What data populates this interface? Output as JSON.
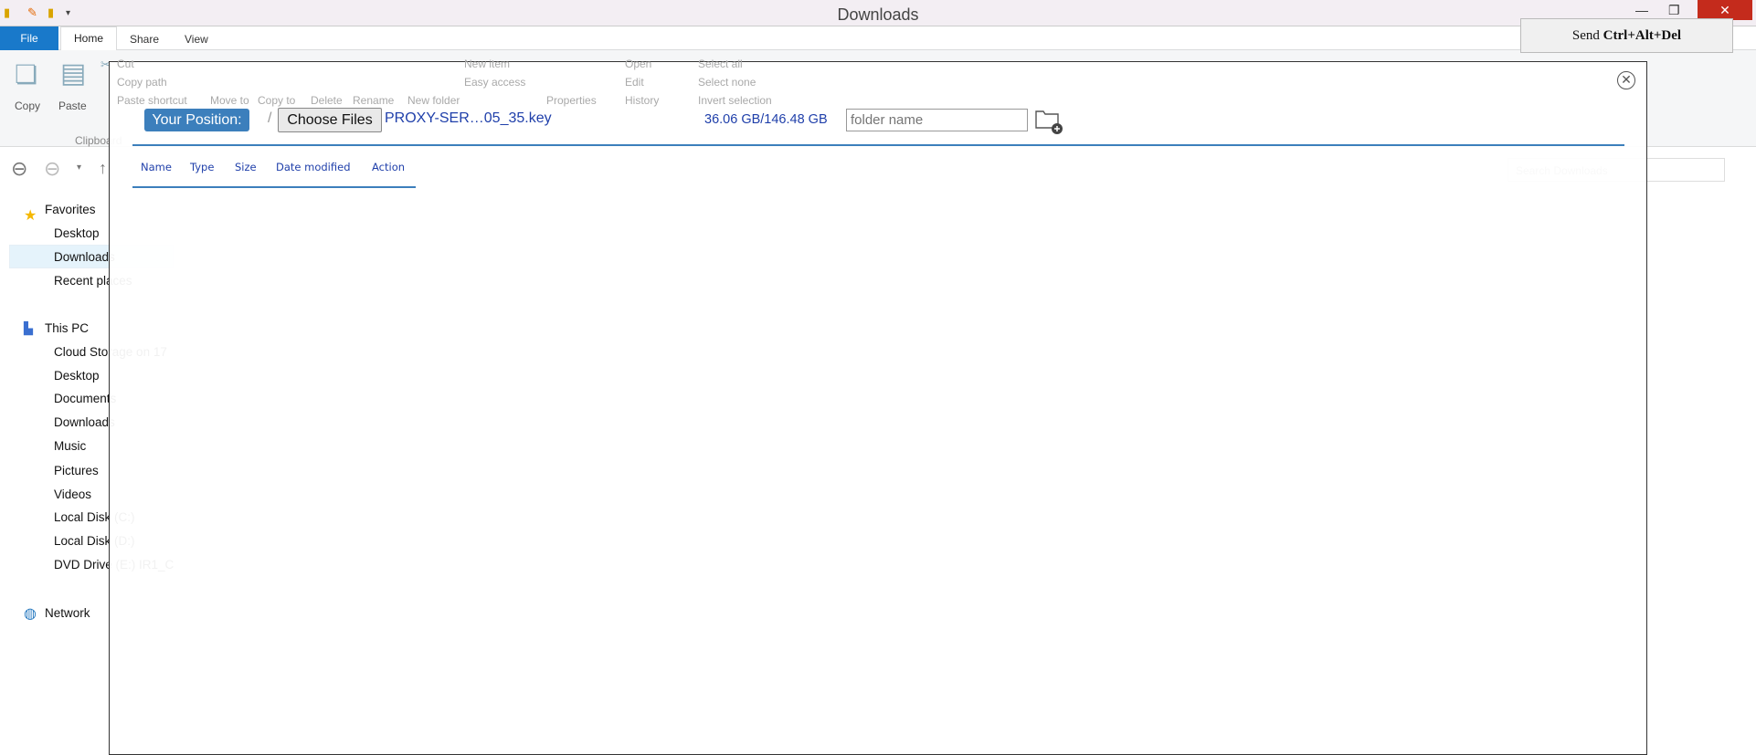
{
  "window": {
    "title": "Downloads"
  },
  "ribbon": {
    "tabs": {
      "file": "File",
      "home": "Home",
      "share": "Share",
      "view": "View"
    },
    "clipboard": {
      "copy": "Copy",
      "paste": "Paste",
      "cut": "Cut",
      "copy_path": "Copy path",
      "paste_shortcut": "Paste shortcut",
      "group": "Clipboard"
    },
    "organize": {
      "move": "Move to",
      "copy": "Copy to",
      "delete": "Delete",
      "rename": "Rename"
    },
    "new": {
      "new_folder": "New folder",
      "new_item": "New item",
      "easy_access": "Easy access"
    },
    "open": {
      "properties": "Properties",
      "open": "Open",
      "edit": "Edit",
      "history": "History"
    },
    "select": {
      "select_all": "Select all",
      "select_none": "Select none",
      "invert": "Invert selection"
    }
  },
  "remote": {
    "send_cad_prefix": "Send ",
    "send_cad_keys": "Ctrl+Alt+Del"
  },
  "search": {
    "placeholder": "Search Downloads"
  },
  "sidebar": {
    "favorites": "Favorites",
    "fav_items": [
      "Desktop",
      "Downloads",
      "Recent places"
    ],
    "this_pc": "This PC",
    "pc_items": [
      "Cloud Storage on 17",
      "Desktop",
      "Documents",
      "Downloads",
      "Music",
      "Pictures",
      "Videos",
      "Local Disk (C:)",
      "Local Disk (D:)",
      "DVD Drive (E:) IR1_C"
    ],
    "network": "Network"
  },
  "modal": {
    "position_label": "Your Position:",
    "path_separator": "/",
    "choose_files": "Choose Files",
    "chosen_file": "PROXY-SER…05_35.key",
    "quota": "36.06 GB/146.48 GB",
    "folder_placeholder": "folder name",
    "columns": [
      "Name",
      "Type",
      "Size",
      "Date modified",
      "Action"
    ],
    "accent": "#3c7fbc"
  }
}
